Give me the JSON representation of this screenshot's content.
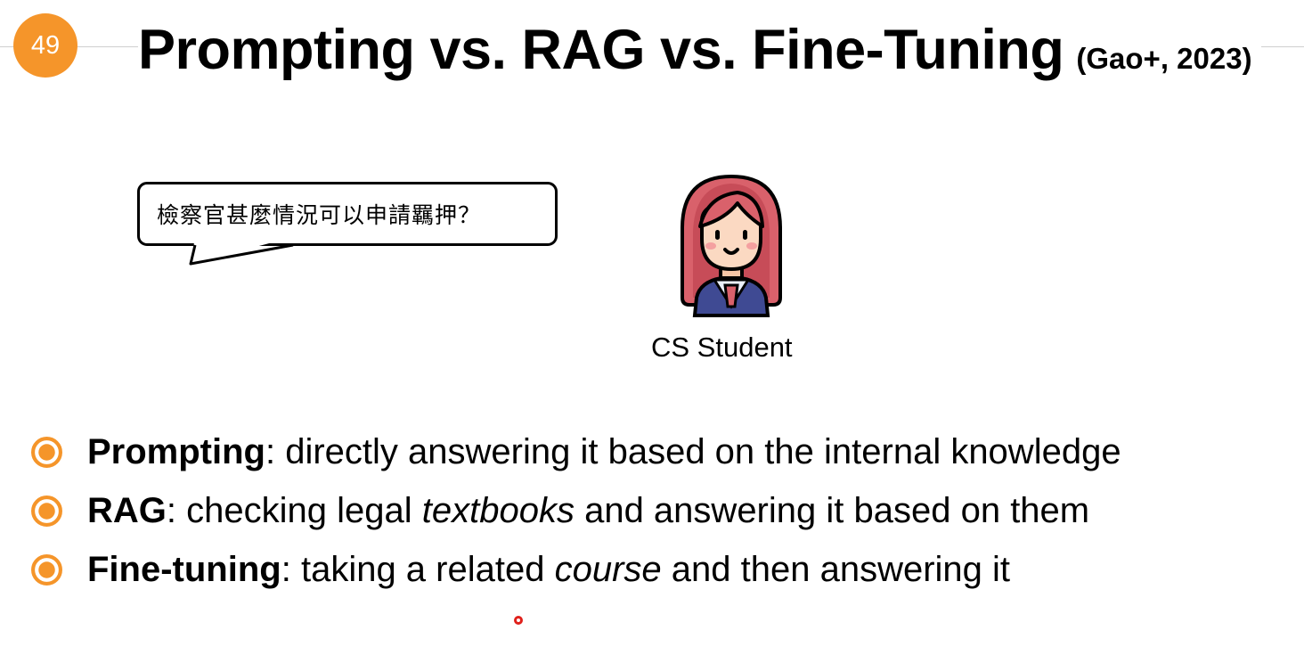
{
  "slide": {
    "number": "49",
    "title": "Prompting vs. RAG vs. Fine-Tuning",
    "citation": "(Gao+, 2023)"
  },
  "bubble": {
    "text": "檢察官甚麼情況可以申請羈押？"
  },
  "avatar": {
    "label": "CS Student",
    "icon": "student-girl-icon"
  },
  "bullets": [
    {
      "term": "Prompting",
      "sep": ":",
      "text_a": " directly answering it based on the internal knowledge",
      "em": "",
      "text_b": ""
    },
    {
      "term": "RAG",
      "sep": ":",
      "text_a": " checking legal ",
      "em": "textbooks",
      "text_b": " and answering it based on them"
    },
    {
      "term": "Fine-tuning",
      "sep": ":",
      "text_a": " taking a related ",
      "em": "course",
      "text_b": " and then answering it"
    }
  ],
  "colors": {
    "accent": "#f5952a",
    "pointer": "#e0201b",
    "hair": "#d9616b",
    "vest": "#3f4a93"
  }
}
